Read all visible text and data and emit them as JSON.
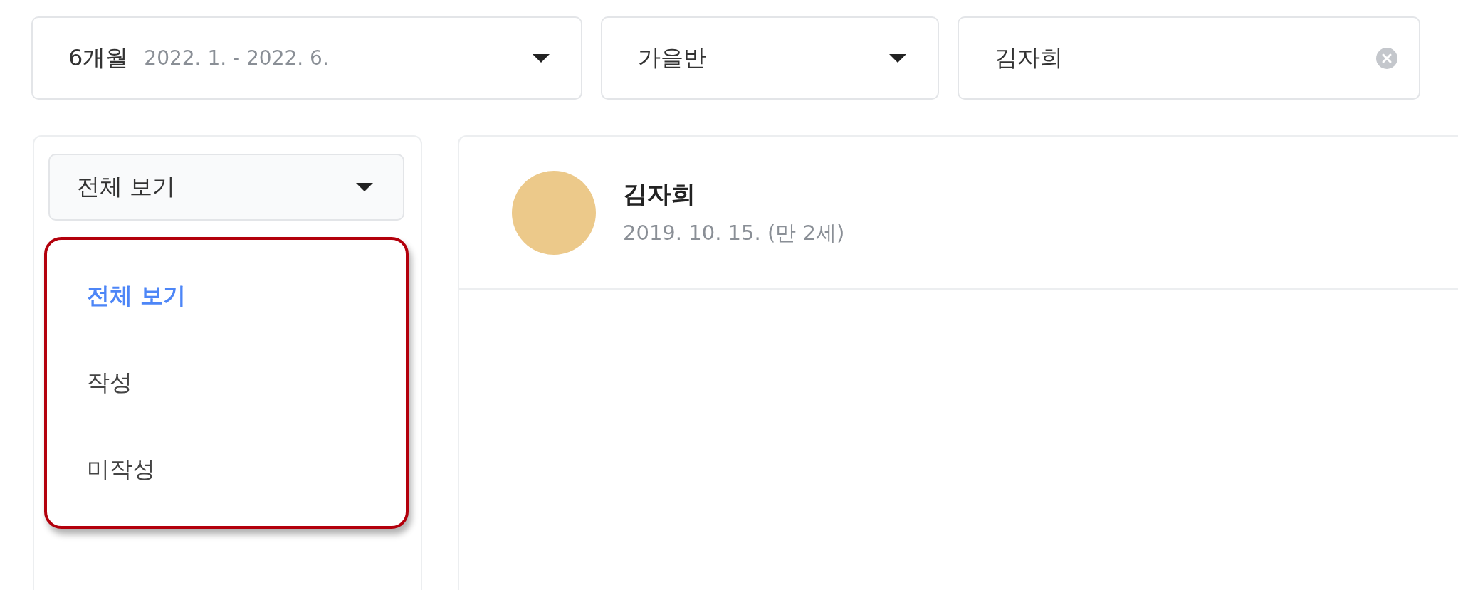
{
  "period_select": {
    "label": "6개월",
    "range": "2022. 1. - 2022. 6."
  },
  "class_select": {
    "value": "가을반"
  },
  "search": {
    "value": "김자희"
  },
  "filter_select": {
    "value": "전체 보기"
  },
  "filter_menu": [
    {
      "label": "전체 보기",
      "selected": true
    },
    {
      "label": "작성",
      "selected": false
    },
    {
      "label": "미작성",
      "selected": false
    }
  ],
  "profile": {
    "name": "김자희",
    "birth": "2019. 10. 15. (만 2세)"
  }
}
